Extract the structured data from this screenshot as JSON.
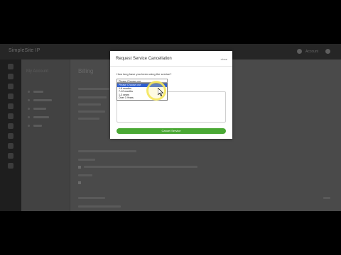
{
  "header": {
    "logo_text": "SimpleSite IP",
    "user_text": "Account"
  },
  "subnav": {
    "title": "My Account"
  },
  "main": {
    "title": "Billing"
  },
  "modal": {
    "title": "Request Service Cancellation",
    "close_label": "close",
    "question": "How long have you been using the service?",
    "select_value": "Please Choose one",
    "options": [
      "Please Choose one",
      "1-6 months",
      "7-12 months",
      "1-3 years",
      "Over 3 Years"
    ],
    "highlighted_option": 0,
    "textarea_value": "",
    "cancel_button_label": "Cancel Service"
  },
  "colors": {
    "accent_green": "#4aa834",
    "highlight_blue": "#2f5fd0",
    "cursor_highlight": "#f4e55c"
  }
}
